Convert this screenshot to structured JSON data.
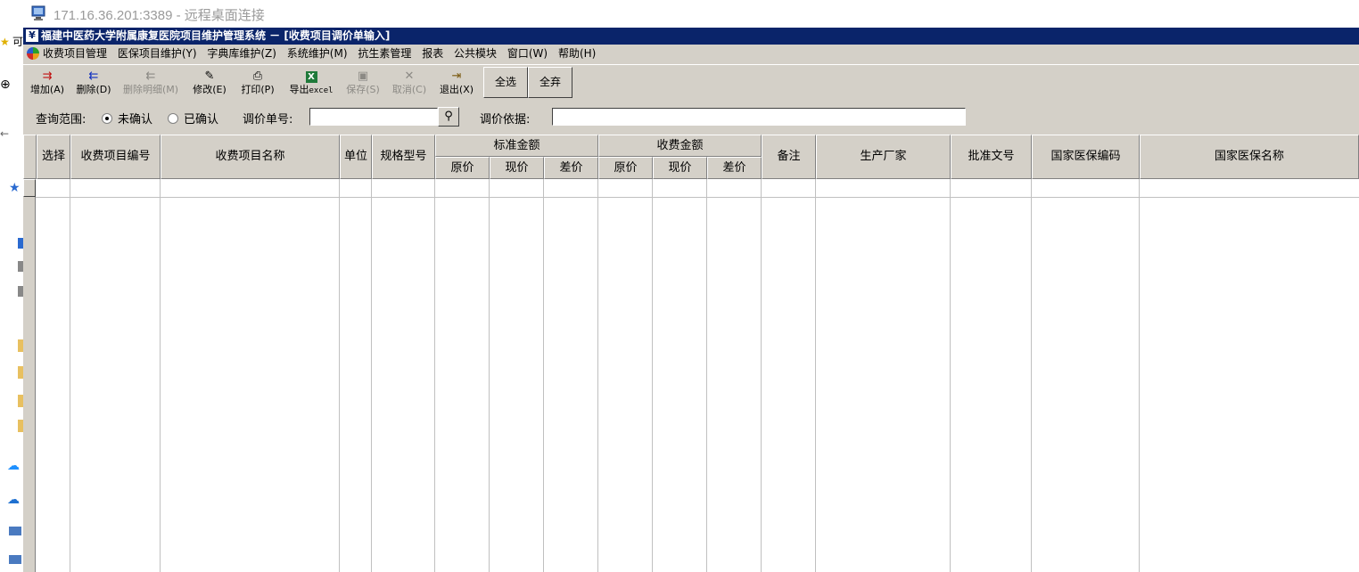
{
  "rdp_title": "171.16.36.201:3389 - 远程桌面连接",
  "left_strip": {
    "fragment": "可"
  },
  "app_title": "福建中医药大学附属康复医院项目维护管理系统 － [收费项目调价单输入]",
  "menus": [
    "收费项目管理",
    "医保项目维护(Y)",
    "字典库维护(Z)",
    "系统维护(M)",
    "抗生素管理",
    "报表",
    "公共模块",
    "窗口(W)",
    "帮助(H)"
  ],
  "toolbar": {
    "add": "增加(A)",
    "delete": "删除(D)",
    "delete_detail": "删除明细(M)",
    "edit": "修改(E)",
    "print": "打印(P)",
    "export_prefix": "导出",
    "export_suffix": "excel",
    "save": "保存(S)",
    "cancel": "取消(C)",
    "exit": "退出(X)",
    "select_all": "全选",
    "deselect_all": "全弃"
  },
  "query": {
    "scope_label": "查询范围:",
    "unconfirmed": "未确认",
    "confirmed": "已确认",
    "selected": "unconfirmed",
    "doc_no_label": "调价单号:",
    "doc_no_value": "",
    "basis_label": "调价依据:",
    "basis_value": ""
  },
  "columns": {
    "select": "选择",
    "code": "收费项目编号",
    "name": "收费项目名称",
    "unit": "单位",
    "spec": "规格型号",
    "std_group": "标准金额",
    "fee_group": "收费金额",
    "orig": "原价",
    "curr": "现价",
    "diff": "差价",
    "remark": "备注",
    "maker": "生产厂家",
    "approval": "批准文号",
    "ins_code": "国家医保编码",
    "ins_name": "国家医保名称"
  },
  "colors": {
    "title_bar": "#0a246a",
    "chrome": "#d4d0c8"
  }
}
